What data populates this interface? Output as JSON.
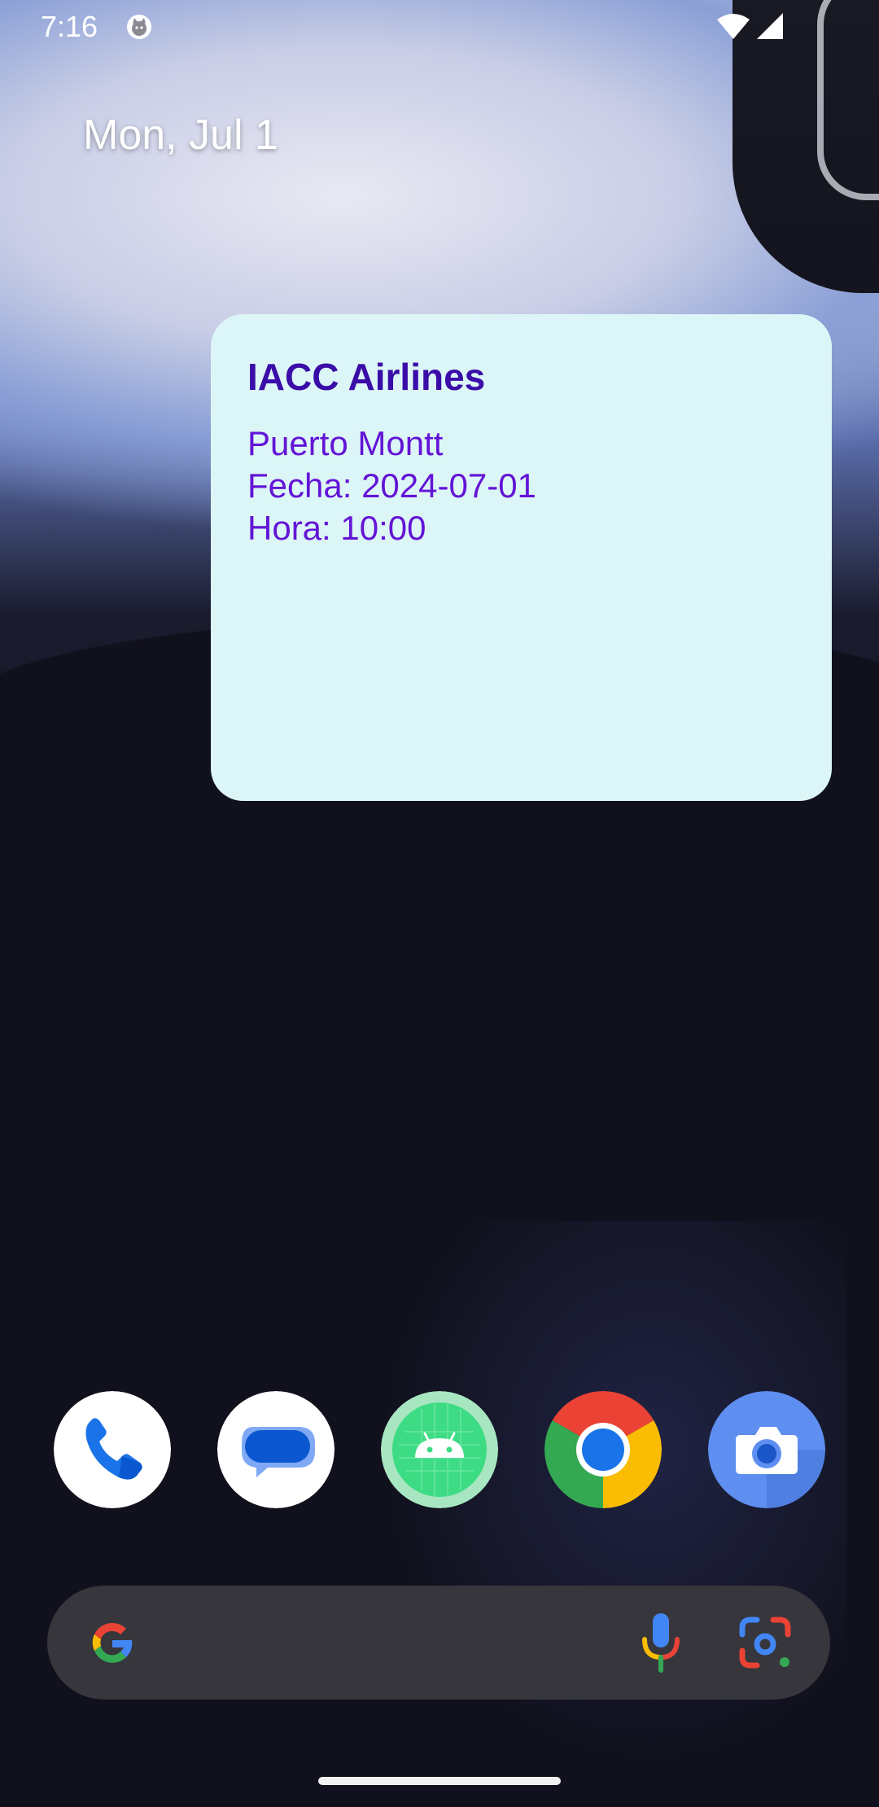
{
  "status_bar": {
    "time": "7:16"
  },
  "home": {
    "date": "Mon, Jul 1"
  },
  "widget": {
    "title": "IACC Airlines",
    "destination": "Puerto Montt",
    "date_line": "Fecha: 2024-07-01",
    "time_line": "Hora: 10:00",
    "background_color": "#dcf5f6",
    "title_color": "#3a0ca8",
    "text_color": "#6314d6"
  },
  "dock": {
    "apps": [
      "phone-icon",
      "messages-icon",
      "android-studio-icon",
      "chrome-icon",
      "camera-icon"
    ]
  },
  "search_bar": {
    "icons": [
      "google-g-icon",
      "microphone-icon",
      "google-lens-icon"
    ]
  }
}
